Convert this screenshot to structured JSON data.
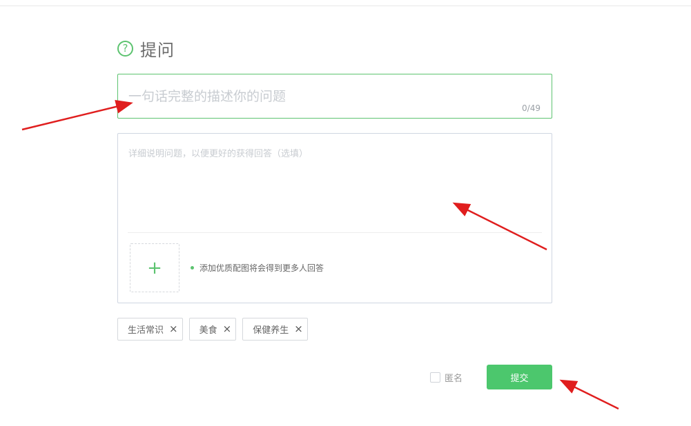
{
  "header": {
    "title": "提问",
    "icon": "question-circle-icon",
    "icon_glyph": "?"
  },
  "title_input": {
    "placeholder": "一句话完整的描述你的问题",
    "value": "",
    "counter": "0/49"
  },
  "detail_input": {
    "placeholder": "详细说明问题，以便更好的获得回答（选填）",
    "value": ""
  },
  "upload": {
    "icon": "plus-icon",
    "plus_glyph": "+",
    "tip": "添加优质配图将会得到更多人回答"
  },
  "tags": [
    {
      "label": "生活常识",
      "remove": "×"
    },
    {
      "label": "美食",
      "remove": "×"
    },
    {
      "label": "保健养生",
      "remove": "×"
    }
  ],
  "anonymous": {
    "label": "匿名",
    "checked": false
  },
  "submit": {
    "label": "提交"
  },
  "colors": {
    "accent": "#4cc76d",
    "annotation_arrow": "#e01e1e"
  }
}
